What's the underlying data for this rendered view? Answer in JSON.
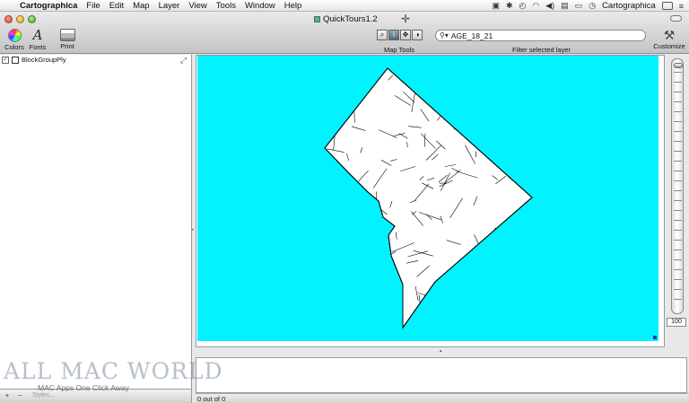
{
  "menubar": {
    "app_name": "Cartographica",
    "items": [
      "File",
      "Edit",
      "Map",
      "Layer",
      "View",
      "Tools",
      "Window",
      "Help"
    ],
    "status_app": "Cartographica"
  },
  "window": {
    "title": "QuickTours1.2"
  },
  "toolbar": {
    "colors_label": "Colors",
    "fonts_label": "Fonts",
    "print_label": "Print",
    "map_tools_label": "Map Tools",
    "filter_value": "AGE_18_21",
    "filter_label": "Filter selected layer",
    "customize_label": "Customize"
  },
  "layers": {
    "items": [
      {
        "name": "BlockGroupPly",
        "visible": true
      }
    ]
  },
  "left_footer": {
    "add": "+",
    "remove": "−",
    "styles": "Styles..."
  },
  "map": {
    "background_color": "#00f3ff",
    "shape_fill": "#ffffff",
    "shape_stroke": "#000000"
  },
  "zoom": {
    "value": "100"
  },
  "status": {
    "selection": "0 out of 0"
  },
  "watermark": {
    "title": "ALL MAC WORLD",
    "subtitle": "MAC Apps One Click Away"
  }
}
